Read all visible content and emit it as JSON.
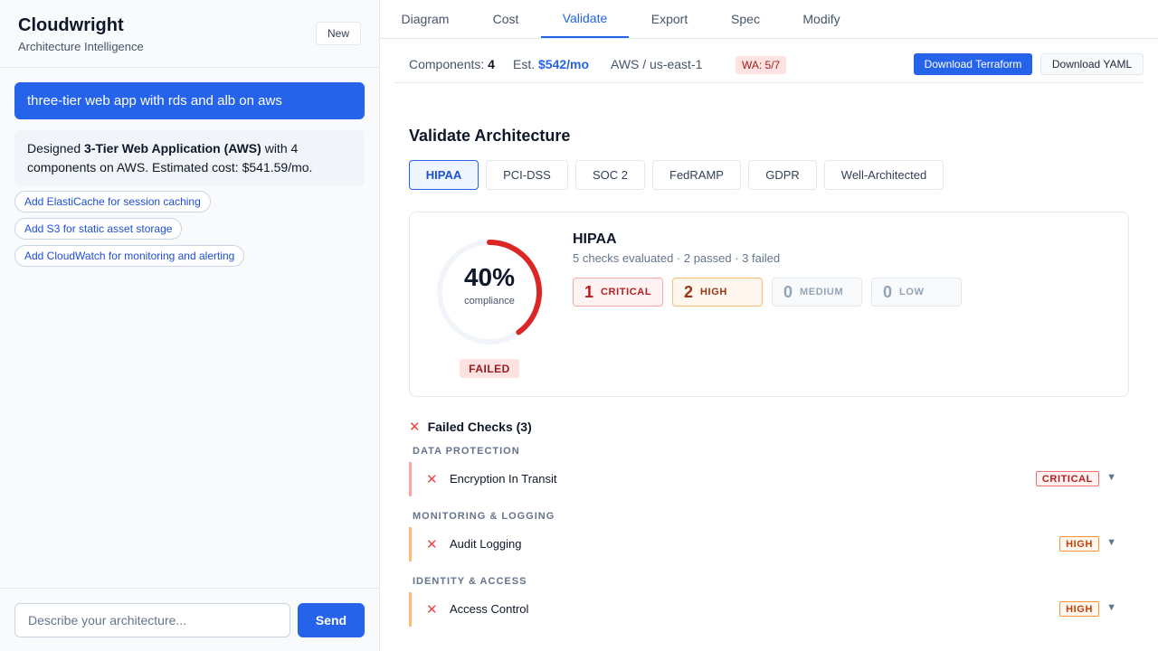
{
  "app": {
    "title": "Cloudwright",
    "subtitle": "Architecture Intelligence",
    "new_label": "New"
  },
  "chat": {
    "user_message": "three-tier web app with rds and alb on aws",
    "bot_prefix": "Designed ",
    "bot_bold": "3-Tier Web Application (AWS)",
    "bot_suffix": " with 4 components on AWS. Estimated cost: $541.59/mo.",
    "suggestions": [
      "Add ElastiCache for session caching",
      "Add S3 for static asset storage",
      "Add CloudWatch for monitoring and alerting"
    ],
    "input_placeholder": "Describe your architecture...",
    "send_label": "Send"
  },
  "tabs": [
    "Diagram",
    "Cost",
    "Validate",
    "Export",
    "Spec",
    "Modify"
  ],
  "active_tab": "Validate",
  "summary": {
    "components_label": "Components:",
    "components_value": "4",
    "est_label": "Est.",
    "est_value": "$542/mo",
    "region": "AWS / us-east-1",
    "wa_badge": "WA: 5/7",
    "download_terraform": "Download Terraform",
    "download_yaml": "Download YAML"
  },
  "validate": {
    "title": "Validate Architecture",
    "frameworks": [
      "HIPAA",
      "PCI-DSS",
      "SOC 2",
      "FedRAMP",
      "GDPR",
      "Well-Architected"
    ],
    "selected_framework": "HIPAA",
    "result": {
      "framework": "HIPAA",
      "compliance_pct": "40%",
      "compliance_value": 0.4,
      "compliance_label": "compliance",
      "status": "FAILED",
      "summary": "5 checks evaluated · 2 passed · 3 failed",
      "severity": {
        "critical": {
          "count": "1",
          "label": "CRITICAL"
        },
        "high": {
          "count": "2",
          "label": "HIGH"
        },
        "medium": {
          "count": "0",
          "label": "MEDIUM"
        },
        "low": {
          "count": "0",
          "label": "LOW"
        }
      }
    },
    "failed_title": "Failed Checks (3)",
    "failed_checks": [
      {
        "category": "DATA PROTECTION",
        "name": "Encryption In Transit",
        "severity": "CRITICAL"
      },
      {
        "category": "MONITORING & LOGGING",
        "name": "Audit Logging",
        "severity": "HIGH"
      },
      {
        "category": "IDENTITY & ACCESS",
        "name": "Access Control",
        "severity": "HIGH"
      }
    ]
  },
  "colors": {
    "accent": "#2563eb",
    "critical": "#dc2626",
    "high": "#f97316",
    "gauge_track": "#f1f5f9"
  }
}
